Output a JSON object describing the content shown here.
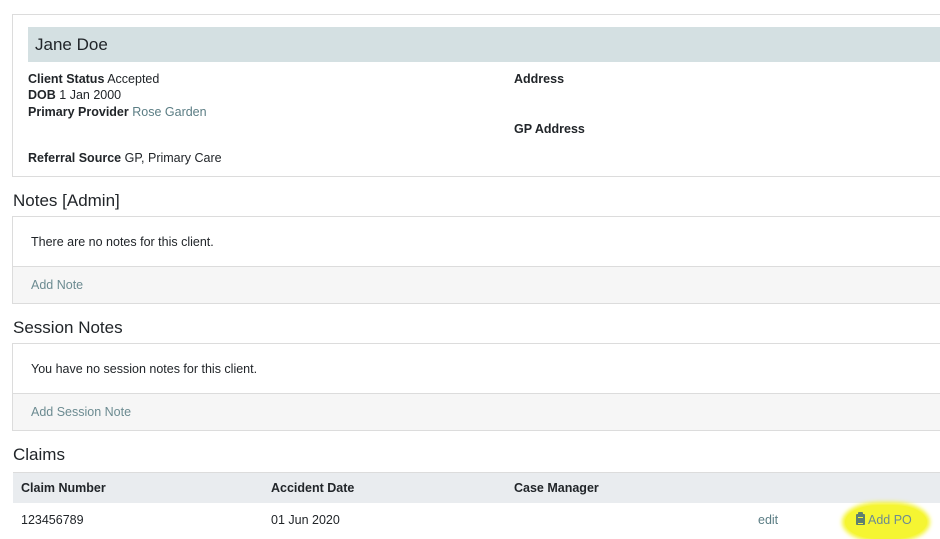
{
  "client": {
    "name": "Jane Doe",
    "status_label": "Client Status",
    "status_value": "Accepted",
    "dob_label": "DOB",
    "dob_value": "1 Jan 2000",
    "provider_label": "Primary Provider",
    "provider_value": "Rose Garden",
    "referral_label": "Referral Source",
    "referral_value": "GP, Primary Care",
    "address_label": "Address",
    "gp_address_label": "GP Address"
  },
  "notes": {
    "title": "Notes [Admin]",
    "empty_text": "There are no notes for this client.",
    "add_label": "Add Note"
  },
  "session_notes": {
    "title": "Session Notes",
    "empty_text": "You have no session notes for this client.",
    "add_label": "Add Session Note"
  },
  "claims": {
    "title": "Claims",
    "columns": [
      "Claim Number",
      "Accident Date",
      "Case Manager"
    ],
    "rows": [
      {
        "claim_number": "123456789",
        "accident_date": "01 Jun 2020",
        "case_manager": "",
        "edit_label": "edit",
        "add_po_label": "Add PO"
      }
    ]
  },
  "icons": {
    "add_po_icon": "clipboard-icon"
  },
  "colors": {
    "header_bg": "#d4e0e2",
    "link": "#5b7d84",
    "highlight": "#f5f532"
  }
}
